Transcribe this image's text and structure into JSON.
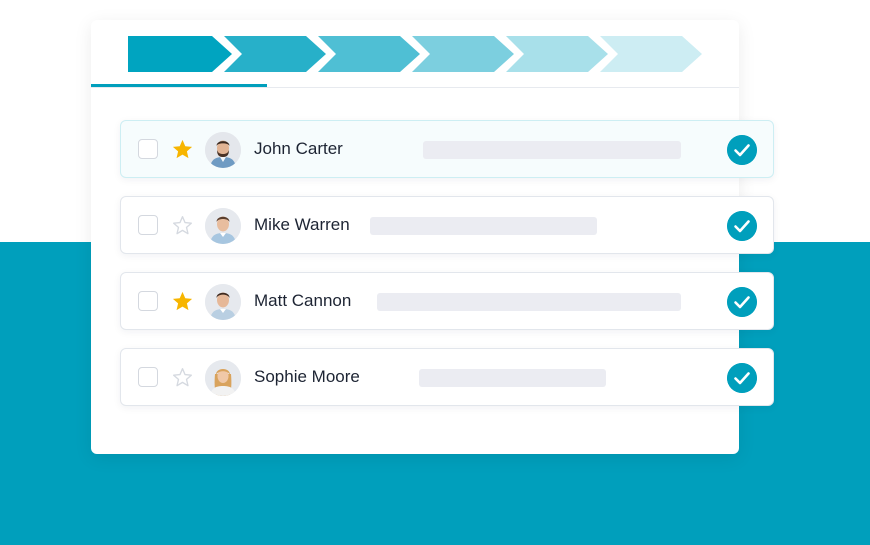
{
  "pipeline": {
    "stages": [
      "stage-1",
      "stage-2",
      "stage-3",
      "stage-4",
      "stage-5",
      "stage-6"
    ],
    "colors": [
      "#00a4c0",
      "#27b0c9",
      "#4fbfd4",
      "#7ccfdf",
      "#a8e0ea",
      "#cdedf3"
    ]
  },
  "contacts": [
    {
      "name": "John Carter",
      "starred": true,
      "completed": true,
      "highlighted": true,
      "avatar": "male-bearded-avatar"
    },
    {
      "name": "Mike Warren",
      "starred": false,
      "completed": true,
      "highlighted": false,
      "avatar": "male-avatar"
    },
    {
      "name": "Matt Cannon",
      "starred": true,
      "completed": true,
      "highlighted": false,
      "avatar": "male-avatar"
    },
    {
      "name": "Sophie Moore",
      "starred": false,
      "completed": true,
      "highlighted": false,
      "avatar": "female-avatar"
    }
  ],
  "colors": {
    "accent": "#009fbc",
    "star_filled": "#f7b500",
    "star_empty": "#d5d9e0",
    "placeholder": "#ebecf2"
  }
}
